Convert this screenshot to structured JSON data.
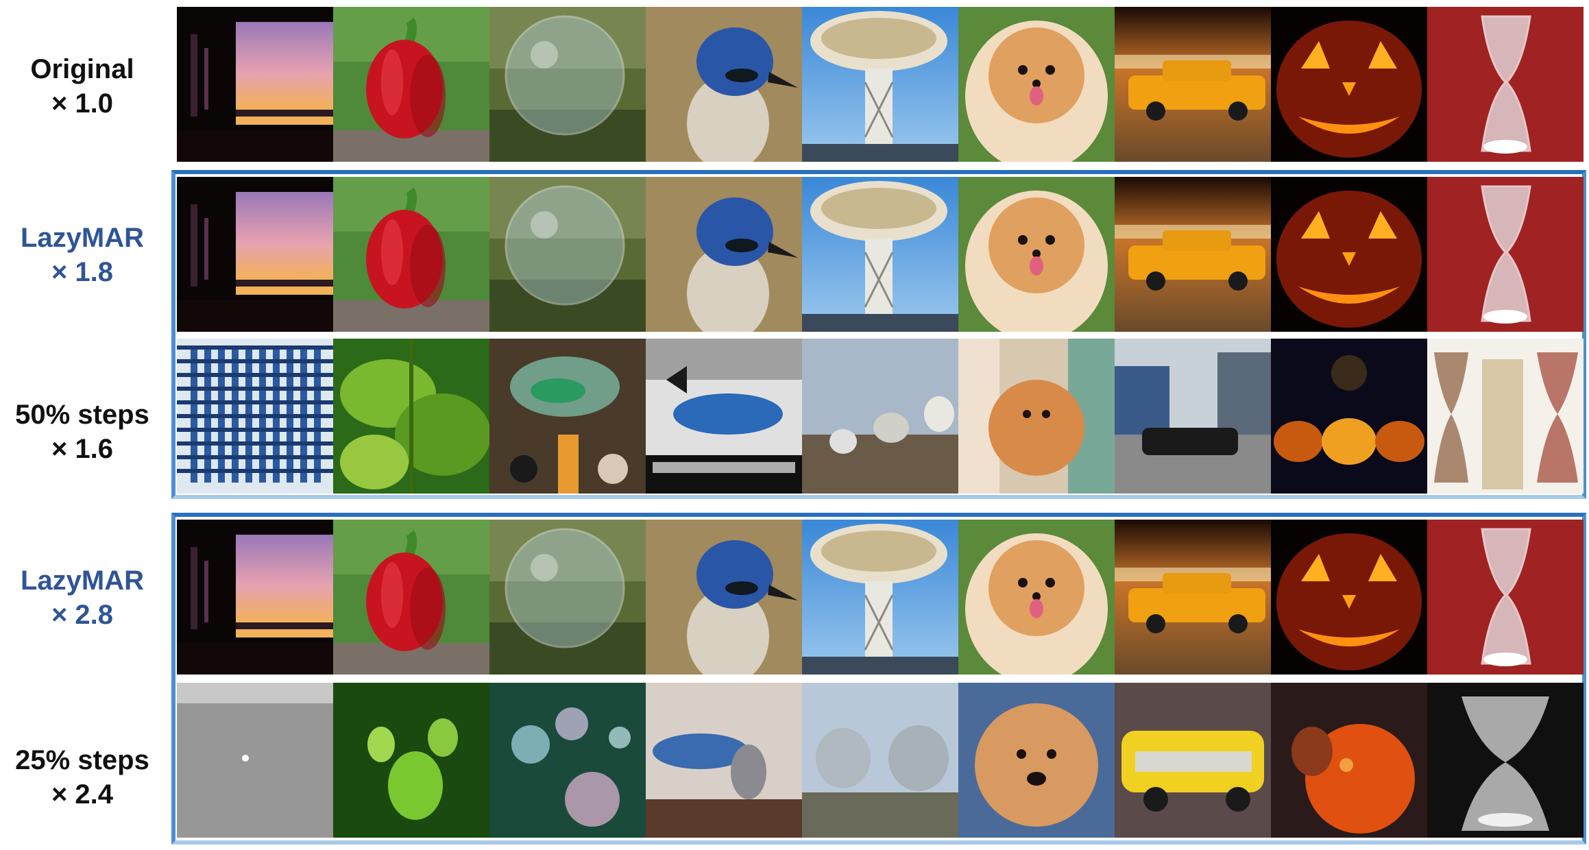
{
  "rows": [
    {
      "id": "original",
      "label_line1": "Original",
      "label_line2": "× 1.0",
      "color": "#111111"
    },
    {
      "id": "lazymar18",
      "label_line1": "LazyMAR",
      "label_line2": "× 1.8",
      "color": "#2f5597"
    },
    {
      "id": "steps50",
      "label_line1": "50% steps",
      "label_line2": "× 1.6",
      "color": "#111111"
    },
    {
      "id": "lazymar28",
      "label_line1": "LazyMAR",
      "label_line2": "× 2.8",
      "color": "#2f5597"
    },
    {
      "id": "steps25",
      "label_line1": "25% steps",
      "label_line2": "× 2.4",
      "color": "#111111"
    }
  ],
  "columns": [
    "sunset-window",
    "red-pepper",
    "soap-bubble",
    "blue-jay",
    "radio-telescope",
    "pomeranian",
    "taxi",
    "jack-o-lantern",
    "hourglass"
  ],
  "accent_color": "#2f5597",
  "frame_color": "#4a8fd4"
}
